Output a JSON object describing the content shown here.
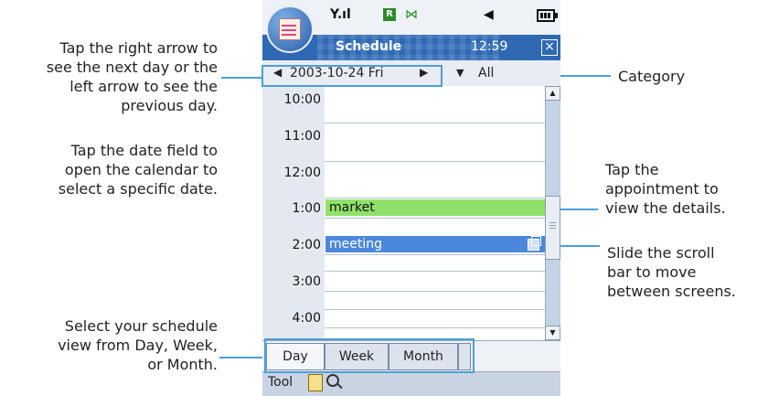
{
  "annotations": {
    "date_nav": "Tap the right arrow to\nsee the next day or the\nleft arrow to see the\nprevious day.",
    "date_field": "Tap the date field to\nopen the calendar to\nselect a specific date.",
    "view_select": "Select your schedule\nview from Day, Week,\nor Month.",
    "category": "Category",
    "appointment": "Tap the\nappointment to\nview the details.",
    "scrollbar": "Slide the scroll\nbar to move\nbetween screens."
  },
  "header": {
    "app_title": "Schedule",
    "clock": "12:59",
    "close": "×",
    "signal": "Y.ıl",
    "roaming": "R",
    "bluetooth": "⋈",
    "volume": "◀"
  },
  "datebar": {
    "prev": "◀",
    "date": "2003-10-24 Fri",
    "next": "▶",
    "category_arrow": "▼",
    "category": "All"
  },
  "schedule": {
    "times": [
      "10:00",
      "11:00",
      "12:00",
      "1:00",
      "2:00",
      "3:00",
      "4:00"
    ],
    "appointments": [
      {
        "time": "1:00",
        "title": "market",
        "color": "#8fe16a"
      },
      {
        "time": "2:00",
        "title": "meeting",
        "color": "#4b88dc"
      }
    ]
  },
  "scroll": {
    "up": "▲",
    "down": "▼"
  },
  "tabs": [
    "Day",
    "Week",
    "Month"
  ],
  "toolbar": {
    "label": "Tool"
  },
  "colors": {
    "accent": "#4aa0d8",
    "title_bar": "#2f69b4"
  }
}
